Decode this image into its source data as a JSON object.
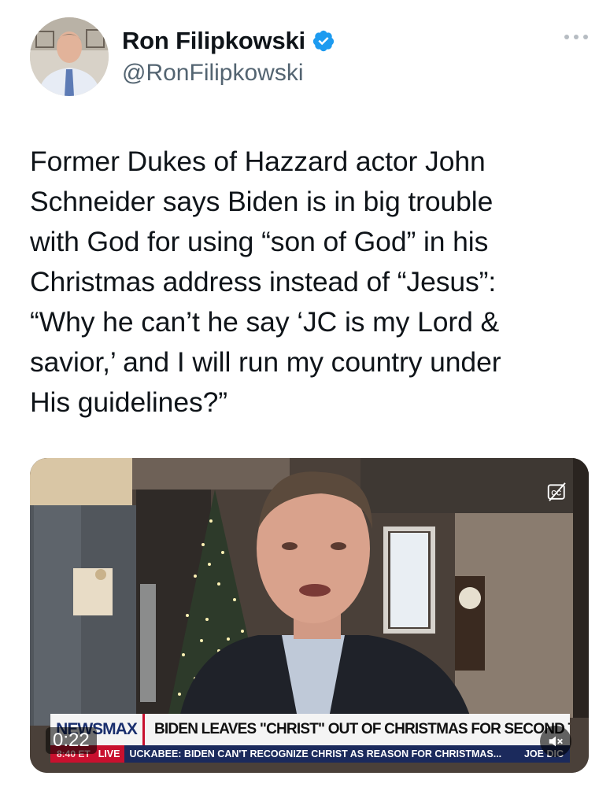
{
  "author": {
    "display_name": "Ron Filipkowski",
    "handle": "@RonFilipkowski",
    "verified": true,
    "verified_color": "#1d9bf0",
    "avatar_icon": "profile-photo"
  },
  "tweet": {
    "text": "Former Dukes of Hazzard actor John\nSchneider says Biden is in big trouble\nwith God for using “son of God” in his\nChristmas address instead of “Jesus”:\n“Why he can’t he say ‘JC is my Lord &\nsavior,’ and I will run my country under\nHis guidelines?”"
  },
  "video": {
    "timestamp": "0:22",
    "cc_icon": "closed-captions-icon",
    "mute_icon": "speaker-muted-icon",
    "chyron": {
      "logo": "NEWSMAX",
      "headline": "BIDEN LEAVES \"CHRIST\" OUT OF CHRISTMAS FOR SECOND TIME",
      "ticker_time": "8:40 ET",
      "ticker_live": "LIVE",
      "ticker_text": "UCKABEE: BIDEN CAN'T RECOGNIZE CHRIST AS REASON FOR CHRISTMAS...",
      "ticker_right": "JOE DIC"
    }
  },
  "more_icon": "more-options-icon"
}
